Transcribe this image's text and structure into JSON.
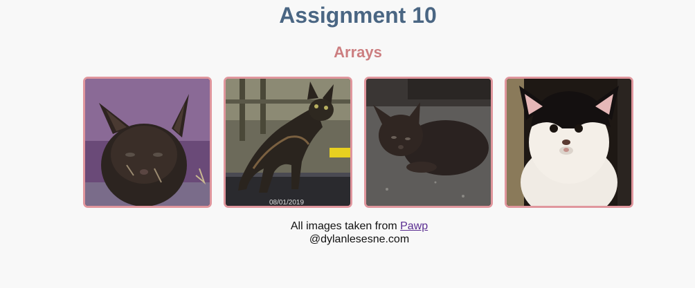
{
  "header": {
    "title": "Assignment 10",
    "subtitle": "Arrays"
  },
  "gallery": {
    "images": [
      {
        "icon": "kitten-photo-1"
      },
      {
        "icon": "kitten-photo-2",
        "caption": "08/01/2019"
      },
      {
        "icon": "kitten-photo-3"
      },
      {
        "icon": "kitten-photo-4"
      }
    ]
  },
  "footer": {
    "credit_text": "All images taken from ",
    "credit_link": "Pawp",
    "copyright": "@dylanlesesne.com"
  },
  "colors": {
    "title": "#4a6683",
    "subtitle": "#cc7e80",
    "card_border": "#e0969d",
    "link": "#5a2d91",
    "background": "#f8f8f8"
  }
}
